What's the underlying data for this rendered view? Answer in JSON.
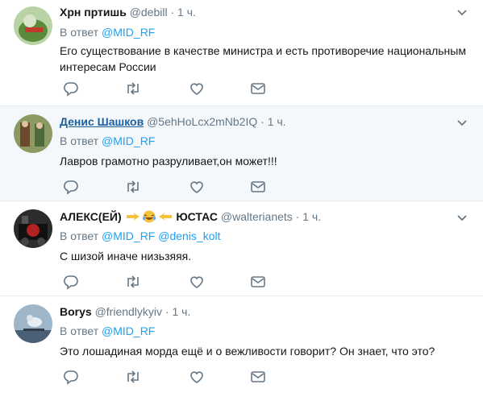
{
  "colors": {
    "accent": "#1da1f2",
    "muted": "#657786",
    "divider": "#e6ecf0",
    "hover_bg": "#f5f8fa"
  },
  "tweets": [
    {
      "name": "Хрн пртишь",
      "handle": "@debill",
      "dot": "·",
      "time": "1 ч.",
      "reply_prefix": "В ответ",
      "mentions": [
        "@MID_RF"
      ],
      "text": "Его существование в качестве министра и есть противоречие национальным интересам России"
    },
    {
      "name": "Денис Шашков",
      "handle": "@5ehHoLcx2mNb2IQ",
      "dot": "·",
      "time": "1 ч.",
      "reply_prefix": "В ответ",
      "mentions": [
        "@MID_RF"
      ],
      "text": "Лавров грамотно разруливает,он может!!!"
    },
    {
      "name": "АЛЕКС(ЕЙ)",
      "name_suffix": "ЮСТАС",
      "name_emojis": [
        "pointing-right-hand-icon",
        "crying-laughing-face-icon",
        "pointing-left-hand-icon"
      ],
      "handle": "@walterianets",
      "dot": "·",
      "time": "1 ч.",
      "reply_prefix": "В ответ",
      "mentions": [
        "@MID_RF",
        "@denis_kolt"
      ],
      "text": "С шизой иначе низьзяяя."
    },
    {
      "name": "Borys",
      "handle": "@friendlykyiv",
      "dot": "·",
      "time": "1 ч.",
      "reply_prefix": "В ответ",
      "mentions": [
        "@MID_RF"
      ],
      "text": "Это лошадиная морда ещё и о вежливости говорит? Он знает, что это?"
    }
  ]
}
